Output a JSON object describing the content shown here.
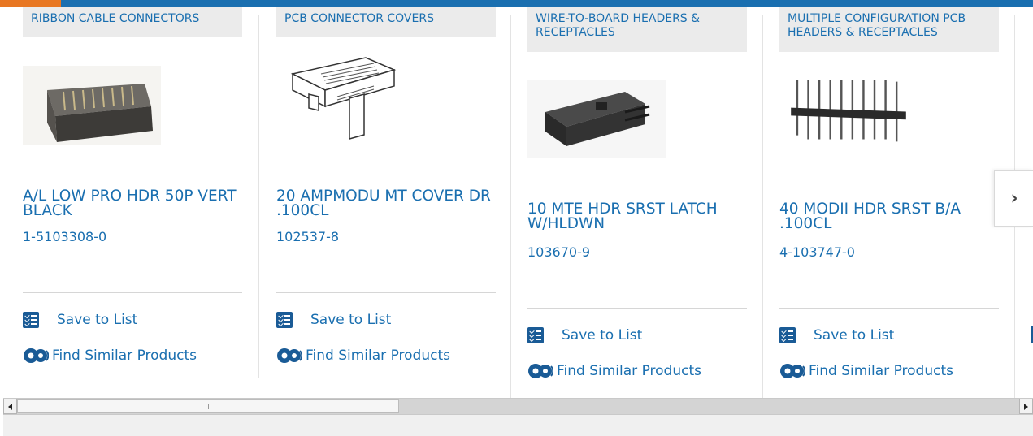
{
  "colors": {
    "accent": "#e87722",
    "brand": "#1a6fb0",
    "icon": "#1a5b96"
  },
  "products": [
    {
      "category": "RIBBON CABLE CONNECTORS",
      "title": "A/L LOW PRO HDR 50P VERT BLACK",
      "part_number": "1-5103308-0",
      "save_label": "Save to List",
      "similar_label": "Find Similar Products"
    },
    {
      "category": "PCB CONNECTOR COVERS",
      "title": "20 AMPMODU MT COVER DR .100CL",
      "part_number": "102537-8",
      "save_label": "Save to List",
      "similar_label": "Find Similar Products"
    },
    {
      "category": "WIRE-TO-BOARD HEADERS & RECEPTACLES",
      "title": "10 MTE HDR SRST LATCH W/HLDWN",
      "part_number": "103670-9",
      "save_label": "Save to List",
      "similar_label": "Find Similar Products"
    },
    {
      "category": "MULTIPLE CONFIGURATION PCB HEADERS & RECEPTACLES",
      "title": "40 MODII HDR SRST B/A .100CL",
      "part_number": "4-103747-0",
      "save_label": "Save to List",
      "similar_label": "Find Similar Products"
    }
  ],
  "carousel": {
    "next_icon": "chevron-right-icon",
    "next_label": "›"
  }
}
